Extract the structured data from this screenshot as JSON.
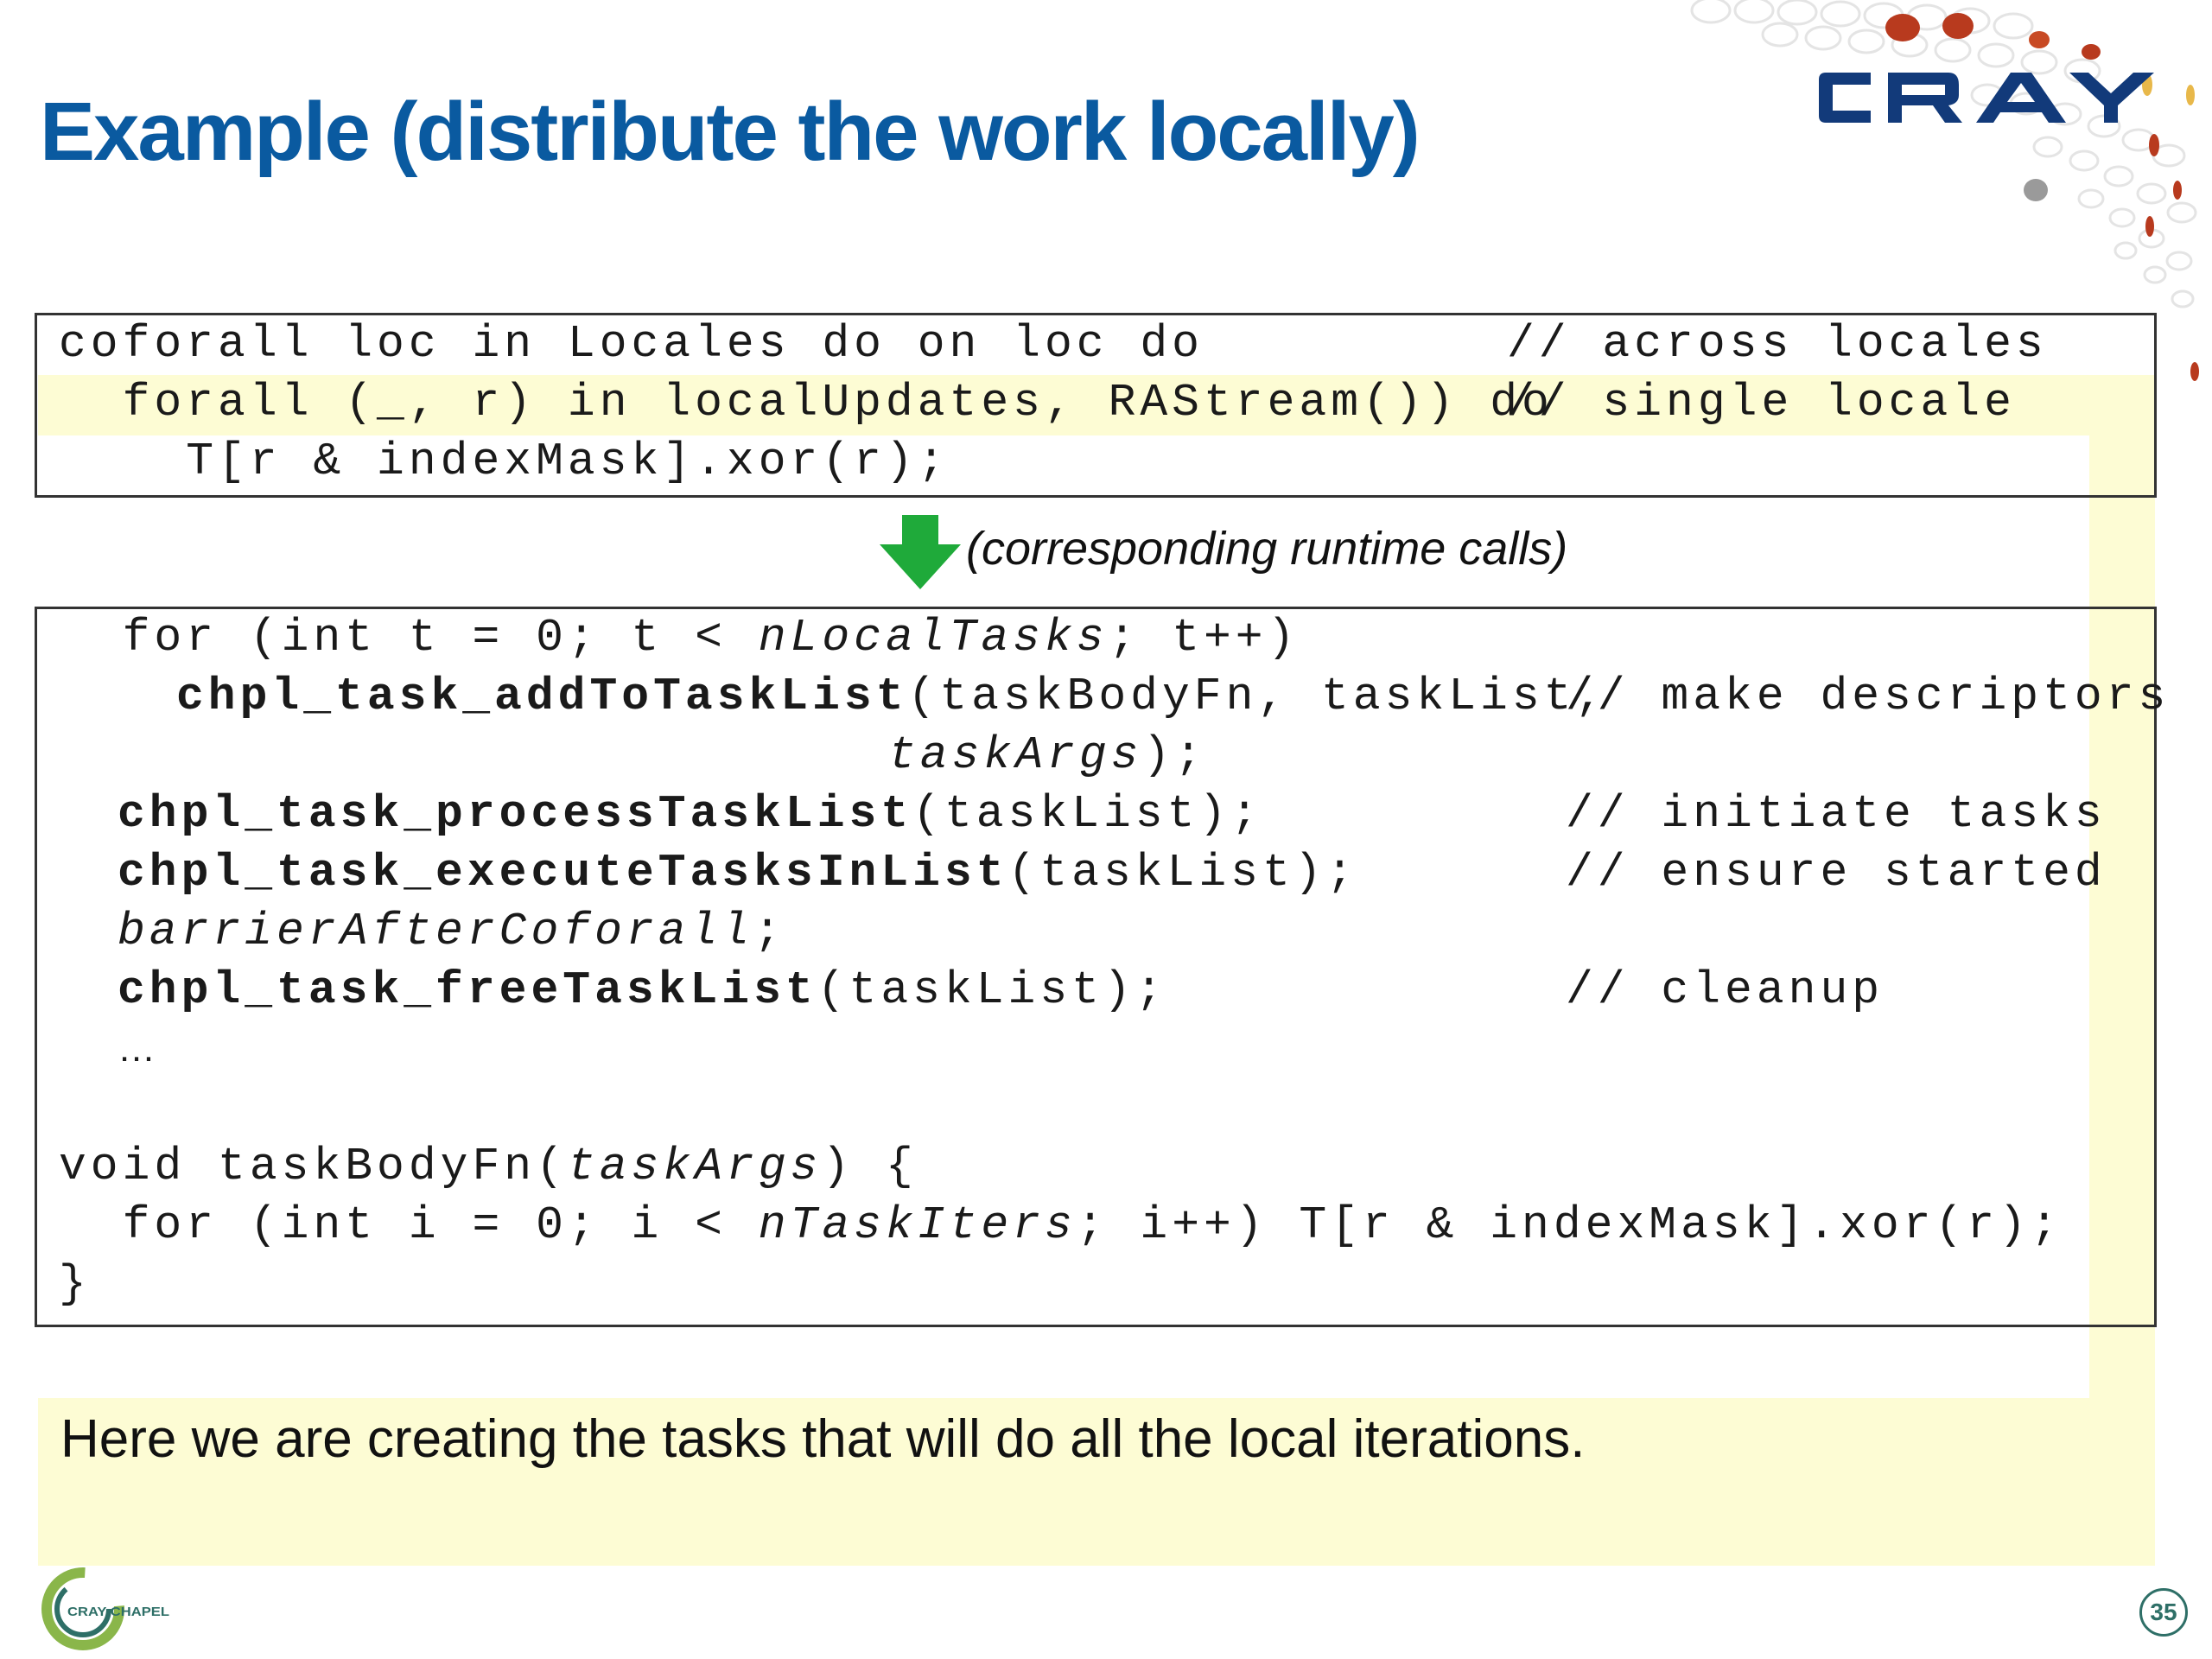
{
  "slide": {
    "title": "Example (distribute the work locally)",
    "brand_logo_text": "CRAY",
    "footer_logo_text": "CRAY CHAPEL",
    "page_number": "35",
    "colors": {
      "title": "#0a5aa0",
      "highlight": "#fdfcd4",
      "arrow": "#1faa3a",
      "logo_navy": "#123a7a",
      "dot_red": "#b83a1e"
    }
  },
  "code_top": {
    "line1_code": "coforall loc in Locales do on loc do",
    "line1_comment": "// across locales",
    "line2_code": "  forall (_, r) in localUpdates, RAStream()) do",
    "line2_comment": "// single locale",
    "line3_code": "    T[r & indexMask].xor(r);"
  },
  "arrow_label": "(corresponding runtime calls)",
  "code_bottom": {
    "l1_a": "  for (int t = 0; t < ",
    "l1_b": "nLocalTasks",
    "l1_c": "; t++)",
    "l2_fn": "chpl_task_addToTaskList",
    "l2_args": "(taskBodyFn, taskList,",
    "l2_comment": "// make descriptors",
    "l3_args": "taskArgs",
    "l3_end": ");",
    "l4_fn": "chpl_task_processTaskList",
    "l4_args": "(taskList);",
    "l4_comment": "// initiate tasks",
    "l5_fn": "chpl_task_executeTasksInList",
    "l5_args": "(taskList);",
    "l5_comment": "// ensure started",
    "l6_a": "barrierAfterCoforall",
    "l6_b": ";",
    "l7_fn": "chpl_task_freeTaskList",
    "l7_args": "(taskList);",
    "l7_comment": "// cleanup",
    "l8": "…",
    "l9_a": "void taskBodyFn(",
    "l9_b": "taskArgs",
    "l9_c": ") {",
    "l10_a": "  for (int i = 0; i < ",
    "l10_b": "nTaskIters",
    "l10_c": "; i++) T[r & indexMask].xor(r);",
    "l11": "}"
  },
  "caption": "Here we are creating the tasks that will do all the local iterations."
}
